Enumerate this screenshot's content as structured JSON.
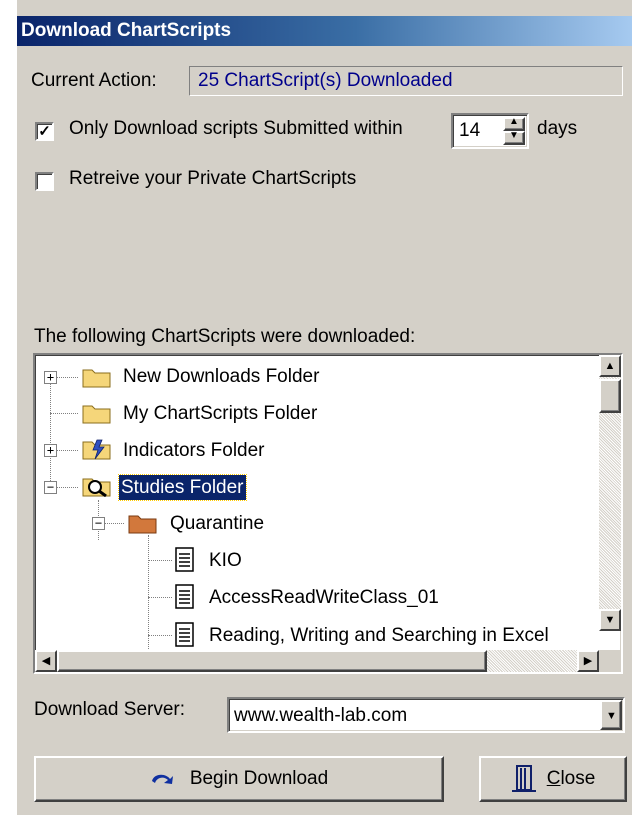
{
  "window": {
    "title": "Download ChartScripts"
  },
  "current_action": {
    "label": "Current Action:",
    "value": "25 ChartScript(s) Downloaded"
  },
  "only_download": {
    "checked": true,
    "label": "Only Download scripts Submitted within",
    "days_value": "14",
    "days_label": "days"
  },
  "private_scripts": {
    "checked": false,
    "label": "Retreive your Private ChartScripts"
  },
  "tree": {
    "heading": "The following ChartScripts were downloaded:",
    "items": [
      {
        "label": "New Downloads Folder",
        "expander": "+",
        "icon": "folder-icon",
        "color": "#f5d67a"
      },
      {
        "label": "My ChartScripts Folder",
        "expander": "",
        "icon": "folder-icon",
        "color": "#f5d67a"
      },
      {
        "label": "Indicators Folder",
        "expander": "+",
        "icon": "indicator-folder-icon",
        "color": "#f5d67a"
      },
      {
        "label": "Studies Folder",
        "expander": "−",
        "icon": "studies-folder-icon",
        "color": "#f5d67a",
        "selected": true
      },
      {
        "label": "Quarantine",
        "expander": "−",
        "icon": "quarantine-folder-icon",
        "color": "#d2783c"
      },
      {
        "label": "KIO",
        "expander": "",
        "icon": "script-file-icon"
      },
      {
        "label": "AccessReadWriteClass_01",
        "expander": "",
        "icon": "script-file-icon"
      },
      {
        "label": "Reading, Writing and Searching in Excel",
        "expander": "",
        "icon": "script-file-icon"
      }
    ]
  },
  "download_server": {
    "label": "Download Server:",
    "value": "www.wealth-lab.com"
  },
  "buttons": {
    "begin_download": "Begin Download",
    "close_prefix": "C",
    "close_rest": "lose"
  },
  "colors": {
    "selection": "#0a246a",
    "title_start": "#0a246a",
    "title_end": "#a6caf0",
    "action_text": "#00008b"
  }
}
